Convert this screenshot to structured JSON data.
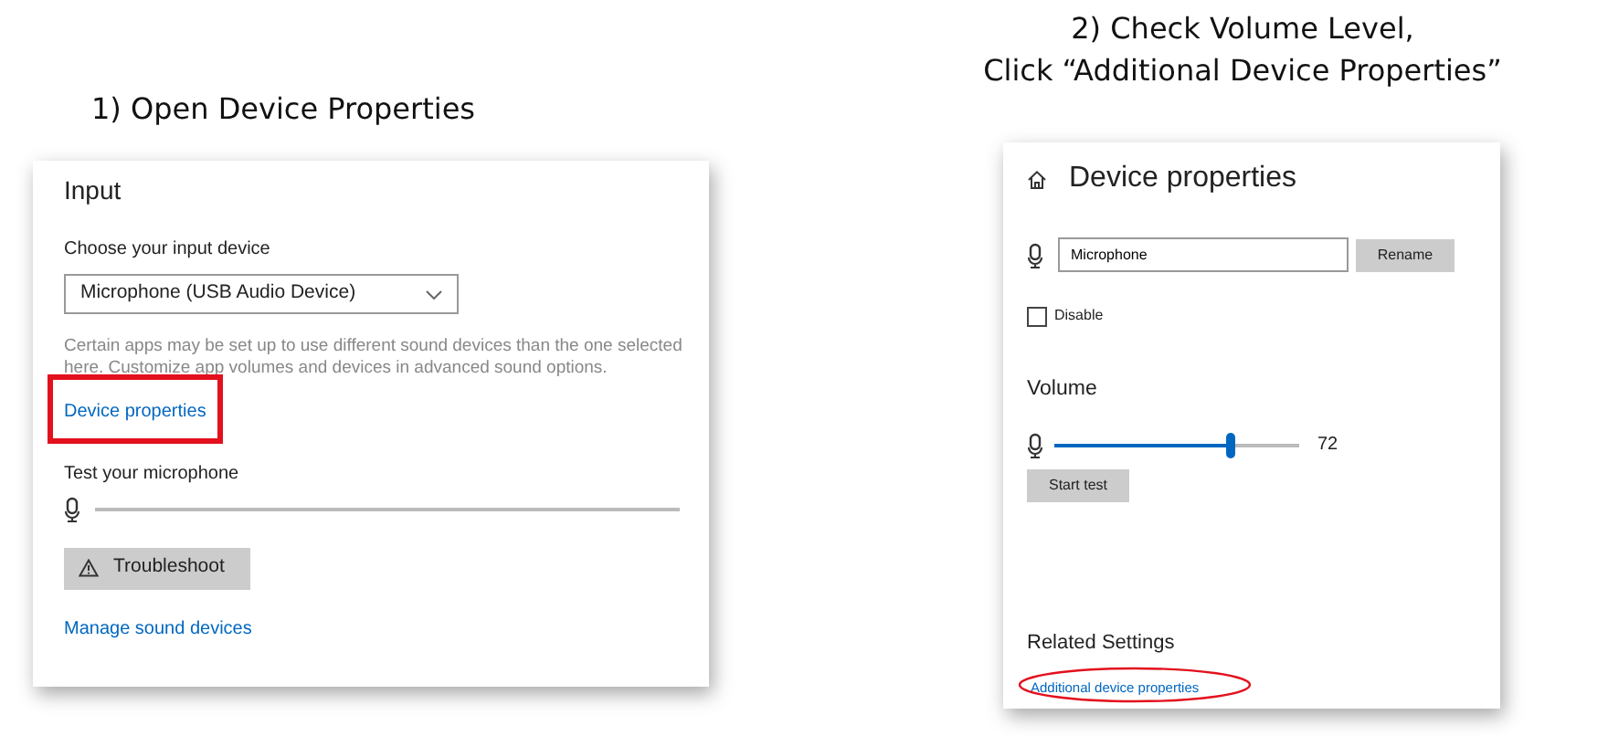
{
  "step_1": {
    "heading": "1) Open Device Properties",
    "panel": {
      "title": "Input",
      "device_label": "Choose your input device",
      "device_dropdown": {
        "value": "Microphone (USB Audio Device)"
      },
      "description": "Certain apps may be set up to use different sound devices than the one selected here. Customize app volumes and devices in advanced sound options.",
      "device_link": {
        "label": "Device properties",
        "highlighted": true,
        "kind": "rectangle"
      },
      "test_label": "Test your microphone",
      "mic_meter": {
        "level": 0
      },
      "troubleshoot_button": "Troubleshoot",
      "manage_link": "Manage sound devices"
    }
  },
  "step_2": {
    "heading_lines": [
      "2) Check Volume Level,",
      "Click “Additional Device Properties”"
    ],
    "panel": {
      "title": "Device properties",
      "name_field": {
        "value": "Microphone"
      },
      "rename_button": "Rename",
      "disable_checkbox": {
        "label": "Disable",
        "checked": false
      },
      "volume_title": "Volume",
      "volume_slider": {
        "level": 0.72
      },
      "volume_reading": "72",
      "start_test_button": "Start test",
      "related_title": "Related Settings",
      "additional_link": {
        "label": "Additional device properties",
        "highlighted": true,
        "kind": "ellipse"
      }
    }
  }
}
